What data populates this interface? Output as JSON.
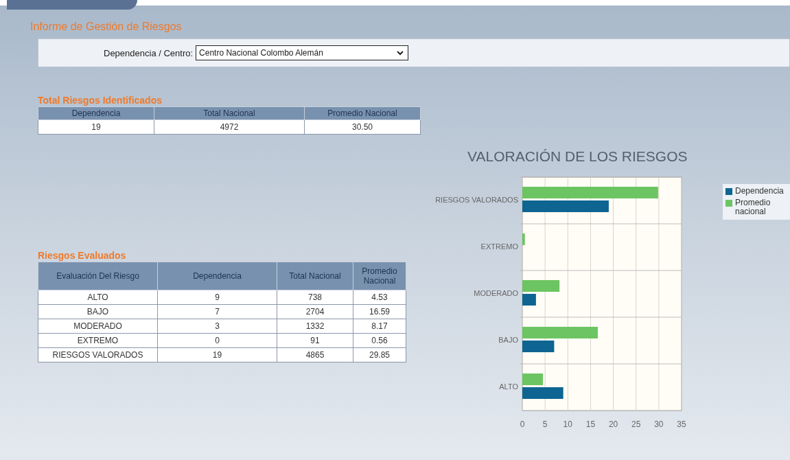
{
  "page_title": "Informe de Gestión de Riesgos",
  "filter": {
    "label": "Dependencia / Centro:",
    "value": "Centro Nacional Colombo Alemán"
  },
  "total_table": {
    "title": "Total Riesgos Identificados",
    "columns": [
      "Dependencia",
      "Total Nacional",
      "Promedio Nacional"
    ],
    "rows": [
      [
        "19",
        "4972",
        "30.50"
      ]
    ]
  },
  "evaluated_table": {
    "title": "Riesgos Evaluados",
    "columns": [
      "Evaluación Del Riesgo",
      "Dependencia",
      "Total Nacional",
      "Promedio Nacional"
    ],
    "rows": [
      [
        "ALTO",
        "9",
        "738",
        "4.53"
      ],
      [
        "BAJO",
        "7",
        "2704",
        "16.59"
      ],
      [
        "MODERADO",
        "3",
        "1332",
        "8.17"
      ],
      [
        "EXTREMO",
        "0",
        "91",
        "0.56"
      ],
      [
        "RIESGOS VALORADOS",
        "19",
        "4865",
        "29.85"
      ]
    ]
  },
  "chart": {
    "chart_data": {
      "type": "bar",
      "orientation": "horizontal",
      "title": "VALORACIÓN DE LOS RIESGOS",
      "categories": [
        "RIESGOS VALORADOS",
        "EXTREMO",
        "MODERADO",
        "BAJO",
        "ALTO"
      ],
      "series": [
        {
          "name": "Dependencia",
          "color": "#0e6592",
          "values": [
            19,
            0,
            3,
            7,
            9
          ]
        },
        {
          "name": "Promedio nacional",
          "color": "#6cc562",
          "values": [
            29.85,
            0.56,
            8.17,
            16.59,
            4.53
          ]
        }
      ],
      "xlim": [
        0,
        35
      ],
      "grid": true,
      "xticks": [
        0,
        5,
        10,
        15,
        20,
        25,
        30,
        35
      ]
    }
  }
}
